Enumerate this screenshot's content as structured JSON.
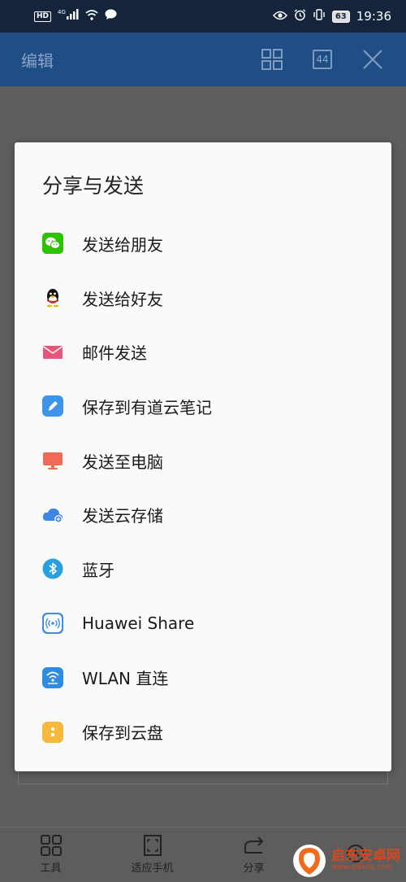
{
  "status_bar": {
    "hd_badge": "HD",
    "network": "4G",
    "battery": "63",
    "time": "19:36"
  },
  "header": {
    "title": "编辑",
    "count": "44"
  },
  "dialog": {
    "title": "分享与发送",
    "items": [
      {
        "label": "发送给朋友",
        "icon": "wechat-icon",
        "color": "#2dc100"
      },
      {
        "label": "发送给好友",
        "icon": "qq-icon",
        "color": "#111111"
      },
      {
        "label": "邮件发送",
        "icon": "mail-icon",
        "color": "#e9557a"
      },
      {
        "label": "保存到有道云笔记",
        "icon": "youdao-note-icon",
        "color": "#3d94e8"
      },
      {
        "label": "发送至电脑",
        "icon": "computer-icon",
        "color": "#f06a55"
      },
      {
        "label": "发送云存储",
        "icon": "cloud-icon",
        "color": "#3f86e0"
      },
      {
        "label": "蓝牙",
        "icon": "bluetooth-icon",
        "color": "#2a9fe0"
      },
      {
        "label": "Huawei Share",
        "icon": "huawei-share-icon",
        "color": "#3d8ee6"
      },
      {
        "label": "WLAN 直连",
        "icon": "wlan-direct-icon",
        "color": "#2f8ce0"
      },
      {
        "label": "保存到云盘",
        "icon": "cloud-disk-icon",
        "color": "#f6b93b"
      }
    ]
  },
  "bottom_bar": {
    "tools": "工具",
    "fit": "适应手机",
    "share": "分享"
  },
  "watermark": {
    "main": "启东安卓网",
    "sub": "www.qdltdq.com"
  }
}
